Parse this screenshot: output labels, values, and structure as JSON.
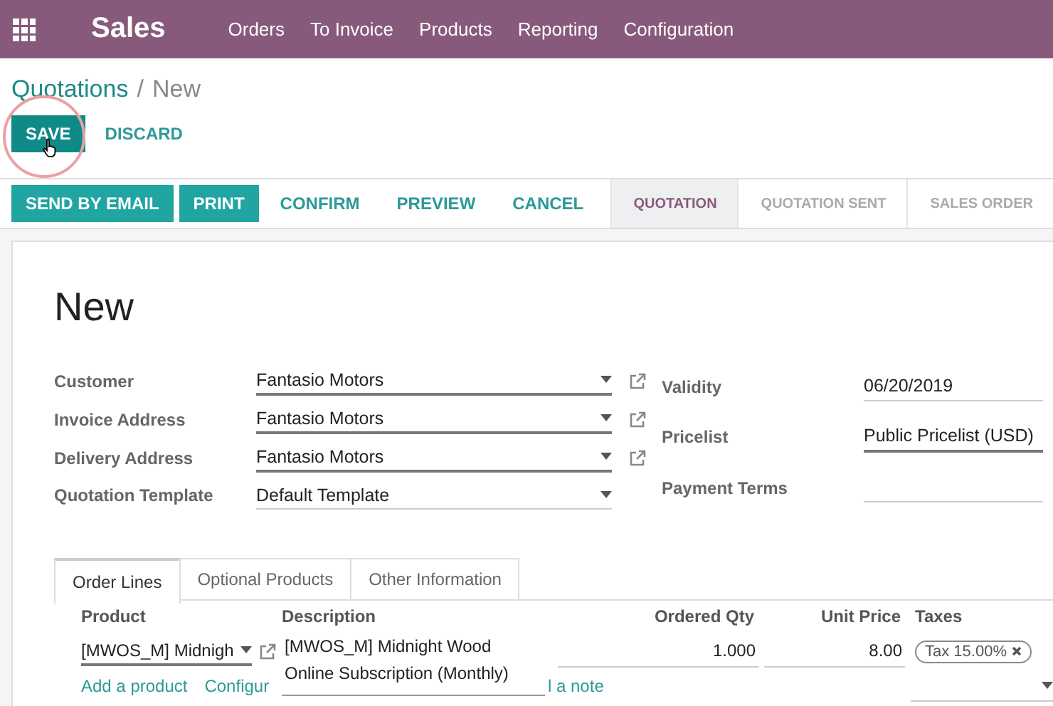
{
  "navbar": {
    "app": "Sales",
    "menus": [
      "Orders",
      "To Invoice",
      "Products",
      "Reporting",
      "Configuration"
    ]
  },
  "breadcrumb": {
    "parent": "Quotations",
    "separator": "/",
    "current": "New"
  },
  "edit_buttons": [
    {
      "label": "SAVE",
      "kind": "primary",
      "highlighted": true
    },
    {
      "label": "DISCARD",
      "kind": "link",
      "highlighted": false
    }
  ],
  "actions": [
    {
      "label": "SEND BY EMAIL",
      "kind": "primary"
    },
    {
      "label": "PRINT",
      "kind": "primary"
    },
    {
      "label": "CONFIRM",
      "kind": "link"
    },
    {
      "label": "PREVIEW",
      "kind": "link"
    },
    {
      "label": "CANCEL",
      "kind": "link"
    }
  ],
  "stages": [
    {
      "label": "QUOTATION",
      "selected": true
    },
    {
      "label": "QUOTATION SENT",
      "selected": false
    },
    {
      "label": "SALES ORDER",
      "selected": false
    }
  ],
  "form": {
    "title": "New",
    "left_fields": [
      {
        "label": "Customer",
        "value": "Fantasio Motors",
        "external_link": true,
        "emphasized": true
      },
      {
        "label": "Invoice Address",
        "value": "Fantasio Motors",
        "external_link": true,
        "emphasized": true
      },
      {
        "label": "Delivery Address",
        "value": "Fantasio Motors",
        "external_link": true,
        "emphasized": true
      },
      {
        "label": "Quotation Template",
        "value": "Default Template",
        "external_link": false,
        "emphasized": false
      }
    ],
    "right_fields": [
      {
        "label": "Validity",
        "value": "06/20/2019",
        "emphasized": false
      },
      {
        "label": "Pricelist",
        "value": "Public Pricelist (USD)",
        "emphasized": true
      },
      {
        "label": "Payment Terms",
        "emphasized": false
      }
    ]
  },
  "tabs": [
    {
      "label": "Order Lines",
      "selected": true
    },
    {
      "label": "Optional Products",
      "selected": false
    },
    {
      "label": "Other Information",
      "selected": false
    }
  ],
  "order_lines": {
    "columns": [
      "Product",
      "Description",
      "Ordered Qty",
      "Unit Price",
      "Taxes"
    ],
    "rows": [
      {
        "product": "[MWOS_M] Midnigh",
        "description": "[MWOS_M] Midnight Wood\nOnline Subscription (Monthly)",
        "quantity": "1.000",
        "unit_price": "8.00",
        "taxes": [
          "Tax 15.00%"
        ]
      }
    ],
    "add_links": [
      "Add a product",
      "Configur",
      "l a note"
    ]
  }
}
